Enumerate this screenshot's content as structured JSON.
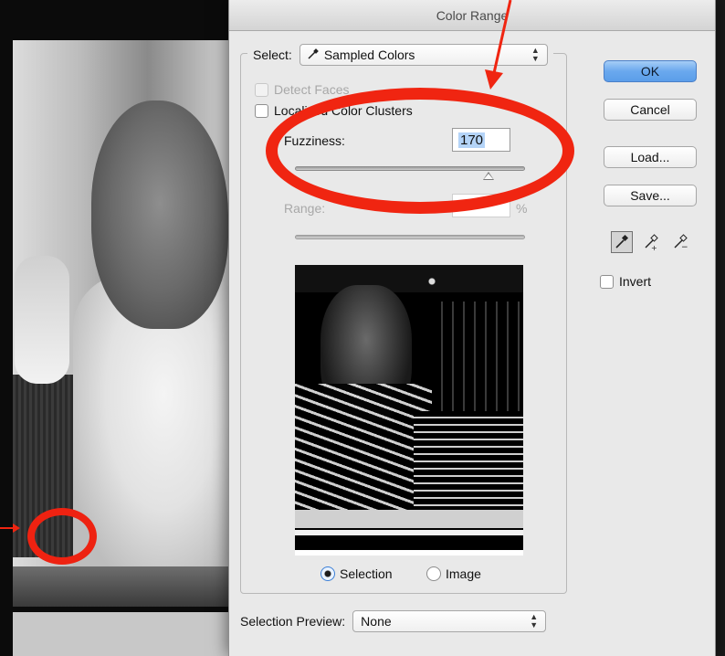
{
  "window": {
    "title": "Color Range"
  },
  "select": {
    "label": "Select:",
    "value": "Sampled Colors"
  },
  "options": {
    "detect_faces": {
      "label": "Detect Faces",
      "checked": false,
      "enabled": false
    },
    "localized_clusters": {
      "label": "Localized Color Clusters",
      "checked": false,
      "enabled": true
    }
  },
  "fuzziness": {
    "label": "Fuzziness:",
    "value": "170"
  },
  "range": {
    "label": "Range:",
    "value": "",
    "unit": "%"
  },
  "preview_mode": {
    "selection_label": "Selection",
    "image_label": "Image",
    "selected": "Selection"
  },
  "selection_preview": {
    "label": "Selection Preview:",
    "value": "None"
  },
  "buttons": {
    "ok": "OK",
    "cancel": "Cancel",
    "load": "Load...",
    "save": "Save..."
  },
  "invert": {
    "label": "Invert",
    "checked": false
  },
  "icons": {
    "eyedropper": "eyedropper-icon",
    "eyedropper_add": "eyedropper-plus-icon",
    "eyedropper_subtract": "eyedropper-minus-icon"
  },
  "colors": {
    "annotation_red": "#f02511",
    "accent_blue": "#5b9ee9"
  }
}
